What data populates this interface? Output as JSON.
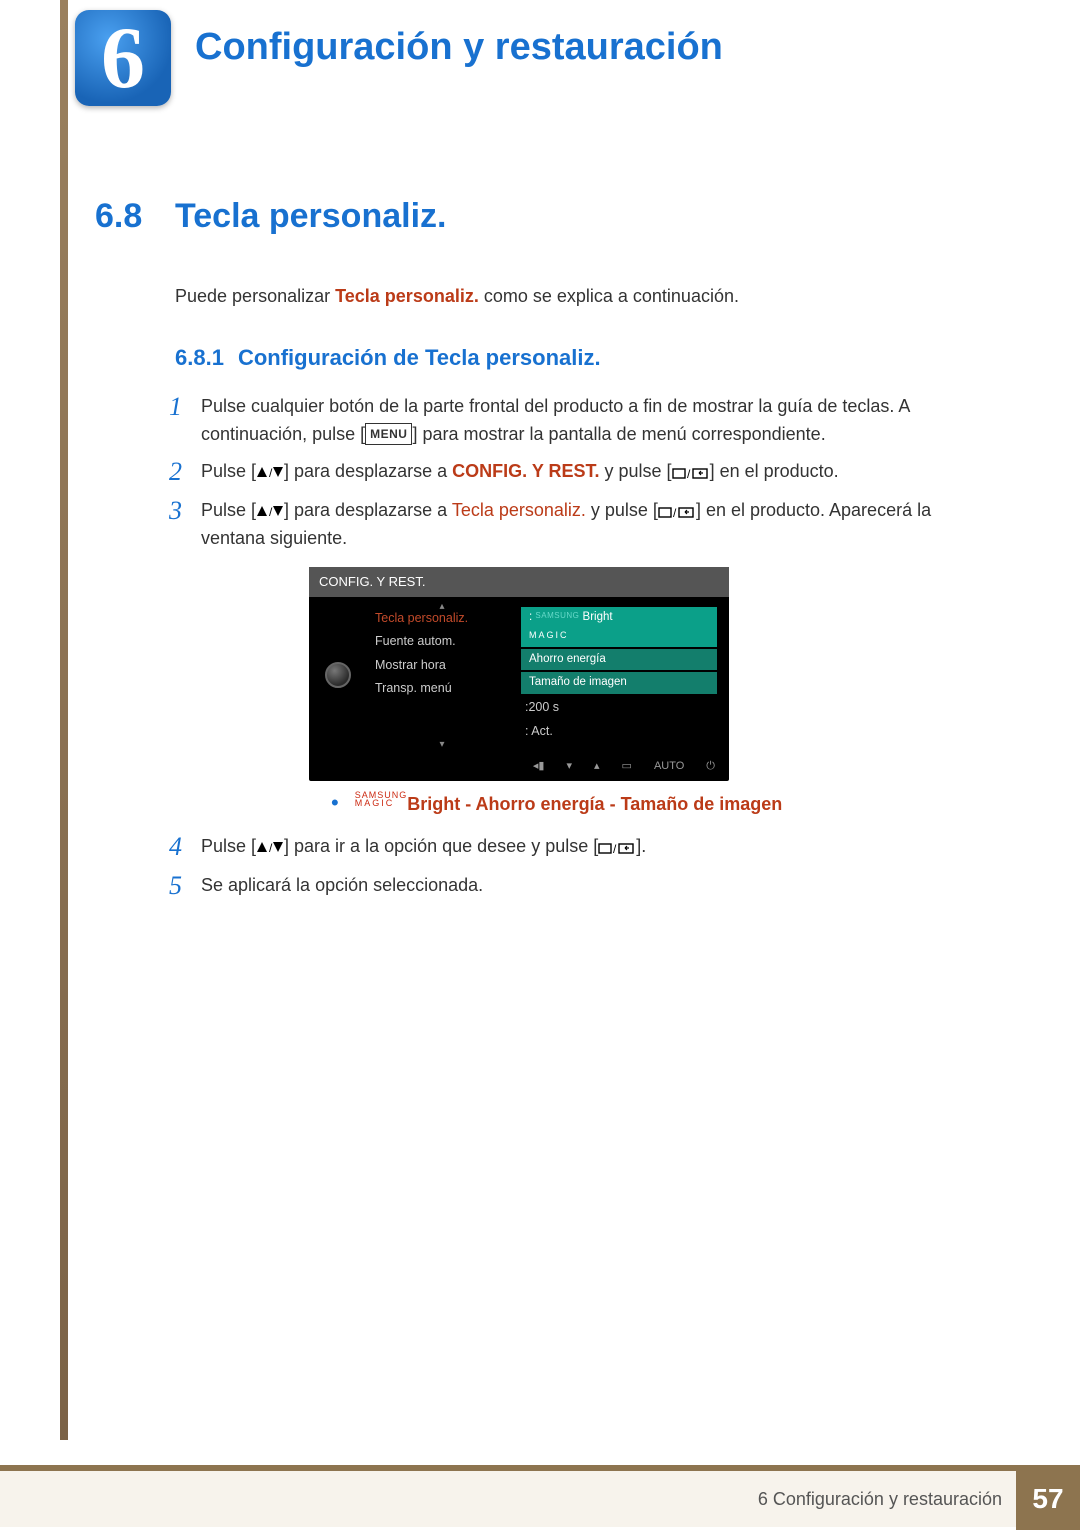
{
  "chapter": {
    "number": "6",
    "title": "Configuración y restauración"
  },
  "section": {
    "number": "6.8",
    "title": "Tecla personaliz."
  },
  "intro": {
    "pre": "Puede personalizar ",
    "bold": "Tecla personaliz.",
    "post": " como se explica a continuación."
  },
  "subsection": {
    "number": "6.8.1",
    "title": "Configuración de Tecla personaliz."
  },
  "steps": {
    "s1a": "Pulse cualquier botón de la parte frontal del producto a fin de mostrar la guía de teclas. A continuación, pulse [",
    "menu_label": "MENU",
    "s1b": "] para mostrar la pantalla de menú correspondiente.",
    "s2a": "Pulse [",
    "s2b": "] para desplazarse a ",
    "s2_target": "CONFIG. Y REST.",
    "s2c": " y pulse [",
    "s2d": "] en el producto.",
    "s3a": "Pulse [",
    "s3b": "] para desplazarse a ",
    "s3_target": "Tecla personaliz.",
    "s3c": " y pulse [",
    "s3d": "] en el producto. Aparecerá la ventana siguiente.",
    "s4a": "Pulse [",
    "s4b": "] para ir a la opción que desee y pulse [",
    "s4c": "].",
    "s5": "Se aplicará la opción seleccionada."
  },
  "osd": {
    "title": "CONFIG. Y REST.",
    "items": [
      {
        "label": "Tecla personaliz.",
        "value_type": "popup"
      },
      {
        "label": "Fuente autom.",
        "value": ""
      },
      {
        "label": "Mostrar hora",
        "value": ":200 s"
      },
      {
        "label": "Transp. menú",
        "value": ": Act."
      }
    ],
    "popup": {
      "brand_small": "SAMSUNG",
      "brand_big": "MAGIC",
      "opt1_suffix": " Bright",
      "opt2": "Ahorro energía",
      "opt3": "Tamaño de imagen"
    },
    "foot_auto": "AUTO"
  },
  "bullet": {
    "brand_small": "SAMSUNG",
    "brand_big": "MAGIC",
    "opt1": "Bright",
    "sep": " - ",
    "opt2": "Ahorro energía",
    "opt3": "Tamaño de imagen"
  },
  "step_numbers": {
    "n1": "1",
    "n2": "2",
    "n3": "3",
    "n4": "4",
    "n5": "5"
  },
  "footer": {
    "text": "6 Configuración y restauración",
    "page": "57"
  }
}
